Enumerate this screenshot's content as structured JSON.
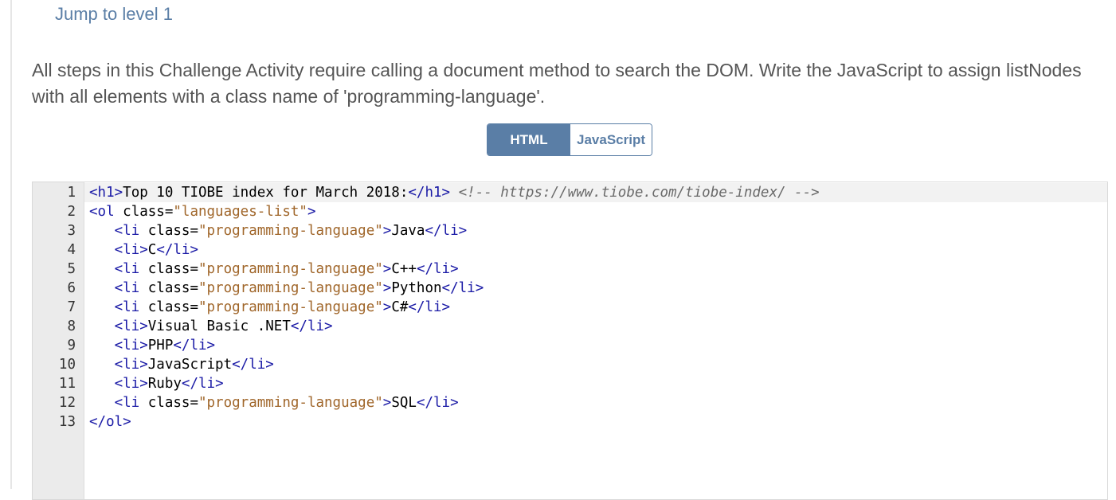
{
  "page": {
    "jump_link": "Jump to level 1",
    "instructions": "All steps in this Challenge Activity require calling a document method to search the DOM. Write the JavaScript to assign listNodes with all elements with a class name of 'programming-language'."
  },
  "tabs": [
    {
      "label": "HTML",
      "active": true
    },
    {
      "label": "JavaScript",
      "active": false
    }
  ],
  "colors": {
    "accent": "#5a7ea6",
    "tag": "#1a1aa6",
    "string": "#a0662a",
    "comment": "#6a6a6a"
  },
  "editor": {
    "lines": [
      {
        "n": "1",
        "tokens": [
          [
            "tag",
            "<h1>"
          ],
          [
            "text",
            "Top 10 TIOBE index for March 2018:"
          ],
          [
            "tag",
            "</h1>"
          ],
          [
            "text",
            " "
          ],
          [
            "comment",
            "<!-- https://www.tiobe.com/tiobe-index/ -->"
          ]
        ]
      },
      {
        "n": "2",
        "tokens": [
          [
            "tag",
            "<ol "
          ],
          [
            "attr",
            "class="
          ],
          [
            "str",
            "\"languages-list\""
          ],
          [
            "tag",
            ">"
          ]
        ]
      },
      {
        "n": "3",
        "tokens": [
          [
            "text",
            "   "
          ],
          [
            "tag",
            "<li "
          ],
          [
            "attr",
            "class="
          ],
          [
            "str",
            "\"programming-language\""
          ],
          [
            "tag",
            ">"
          ],
          [
            "text",
            "Java"
          ],
          [
            "tag",
            "</li>"
          ]
        ]
      },
      {
        "n": "4",
        "tokens": [
          [
            "text",
            "   "
          ],
          [
            "tag",
            "<li>"
          ],
          [
            "text",
            "C"
          ],
          [
            "tag",
            "</li>"
          ]
        ]
      },
      {
        "n": "5",
        "tokens": [
          [
            "text",
            "   "
          ],
          [
            "tag",
            "<li "
          ],
          [
            "attr",
            "class="
          ],
          [
            "str",
            "\"programming-language\""
          ],
          [
            "tag",
            ">"
          ],
          [
            "text",
            "C++"
          ],
          [
            "tag",
            "</li>"
          ]
        ]
      },
      {
        "n": "6",
        "tokens": [
          [
            "text",
            "   "
          ],
          [
            "tag",
            "<li "
          ],
          [
            "attr",
            "class="
          ],
          [
            "str",
            "\"programming-language\""
          ],
          [
            "tag",
            ">"
          ],
          [
            "text",
            "Python"
          ],
          [
            "tag",
            "</li>"
          ]
        ]
      },
      {
        "n": "7",
        "tokens": [
          [
            "text",
            "   "
          ],
          [
            "tag",
            "<li "
          ],
          [
            "attr",
            "class="
          ],
          [
            "str",
            "\"programming-language\""
          ],
          [
            "tag",
            ">"
          ],
          [
            "text",
            "C#"
          ],
          [
            "tag",
            "</li>"
          ]
        ]
      },
      {
        "n": "8",
        "tokens": [
          [
            "text",
            "   "
          ],
          [
            "tag",
            "<li>"
          ],
          [
            "text",
            "Visual Basic .NET"
          ],
          [
            "tag",
            "</li>"
          ]
        ]
      },
      {
        "n": "9",
        "tokens": [
          [
            "text",
            "   "
          ],
          [
            "tag",
            "<li>"
          ],
          [
            "text",
            "PHP"
          ],
          [
            "tag",
            "</li>"
          ]
        ]
      },
      {
        "n": "10",
        "tokens": [
          [
            "text",
            "   "
          ],
          [
            "tag",
            "<li>"
          ],
          [
            "text",
            "JavaScript"
          ],
          [
            "tag",
            "</li>"
          ]
        ]
      },
      {
        "n": "11",
        "tokens": [
          [
            "text",
            "   "
          ],
          [
            "tag",
            "<li>"
          ],
          [
            "text",
            "Ruby"
          ],
          [
            "tag",
            "</li>"
          ]
        ]
      },
      {
        "n": "12",
        "tokens": [
          [
            "text",
            "   "
          ],
          [
            "tag",
            "<li "
          ],
          [
            "attr",
            "class="
          ],
          [
            "str",
            "\"programming-language\""
          ],
          [
            "tag",
            ">"
          ],
          [
            "text",
            "SQL"
          ],
          [
            "tag",
            "</li>"
          ]
        ]
      },
      {
        "n": "13",
        "tokens": [
          [
            "tag",
            "</ol>"
          ]
        ]
      }
    ]
  }
}
